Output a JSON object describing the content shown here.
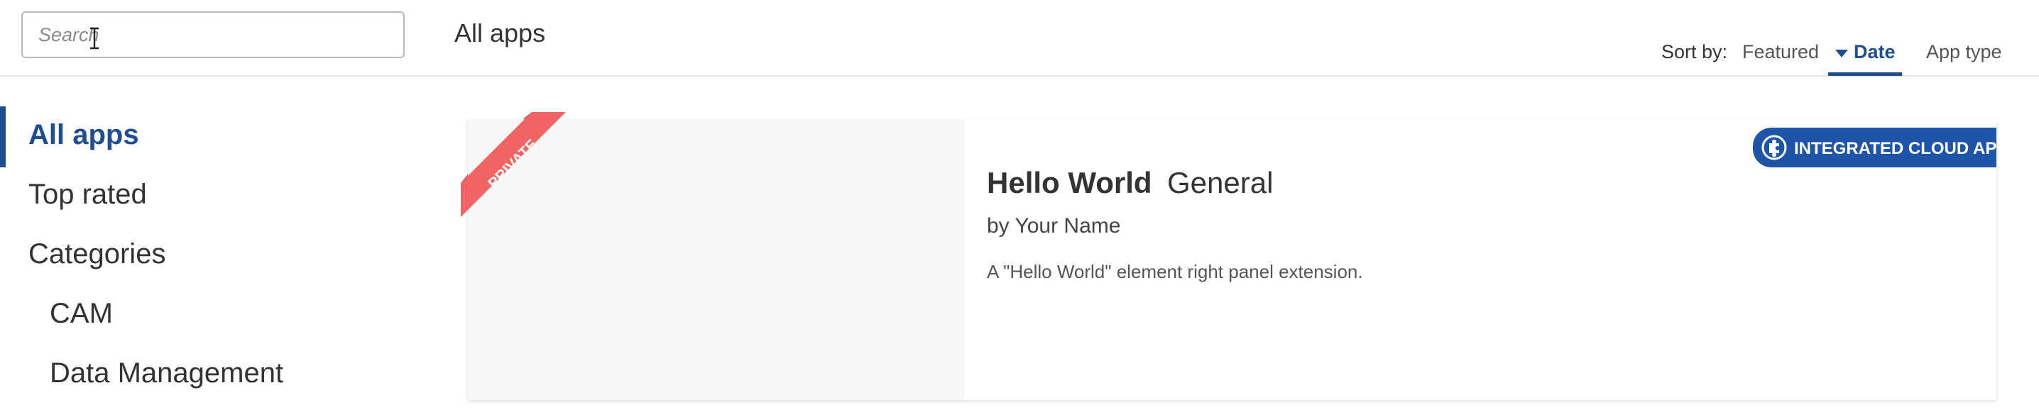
{
  "search": {
    "placeholder": "Search",
    "value": ""
  },
  "page": {
    "heading": "All apps"
  },
  "sort": {
    "label": "Sort by:",
    "options": [
      {
        "label": "Featured",
        "selected": false
      },
      {
        "label": "Date",
        "selected": true
      },
      {
        "label": "App type",
        "selected": false
      }
    ]
  },
  "sidebar": {
    "items": [
      {
        "label": "All apps",
        "active": true
      },
      {
        "label": "Top rated",
        "active": false
      },
      {
        "label": "Categories",
        "active": false
      },
      {
        "label": "CAM",
        "active": false
      },
      {
        "label": "Data Management",
        "active": false
      }
    ]
  },
  "apps": [
    {
      "ribbon": "PRIVATE",
      "name": "Hello World",
      "category": "General",
      "author": "by Your Name",
      "description": "A \"Hello World\" element right panel extension.",
      "type_badge": "INTEGRATED CLOUD APP",
      "type_icon": "puzzle-icon"
    }
  ],
  "colors": {
    "accent": "#1f4d8f",
    "badge": "#1f55a8",
    "ribbon": "#f26464",
    "ribbon_fold": "#c0392b",
    "thumbnail_bg": "#f7f7f7"
  }
}
